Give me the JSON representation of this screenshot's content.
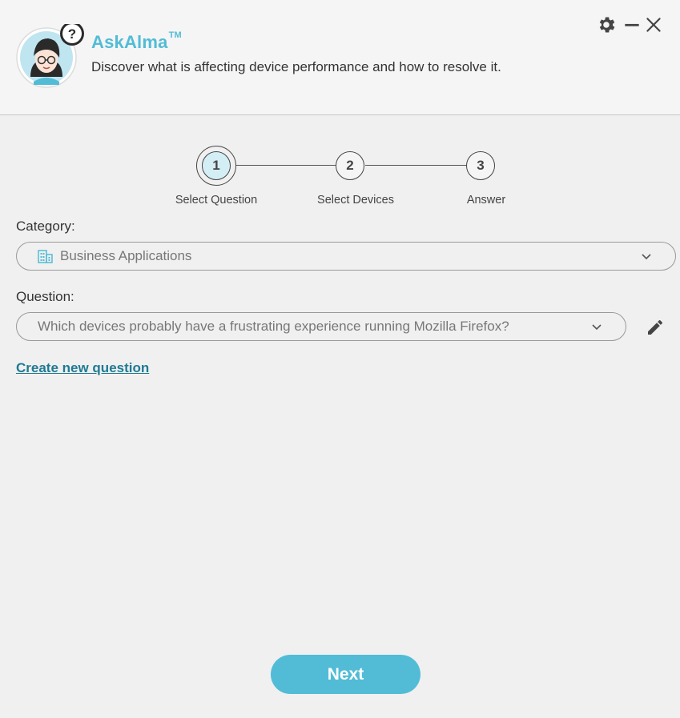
{
  "header": {
    "title": "AskAlma",
    "trademark": "TM",
    "subtitle": "Discover what is affecting device performance and how to resolve it.",
    "help_badge": "?"
  },
  "window_controls": [
    "gear-icon",
    "minimize-icon",
    "close-icon"
  ],
  "stepper": {
    "steps": [
      {
        "number": "1",
        "label": "Select Question",
        "active": true
      },
      {
        "number": "2",
        "label": "Select Devices",
        "active": false
      },
      {
        "number": "3",
        "label": "Answer",
        "active": false
      }
    ]
  },
  "category": {
    "label": "Category:",
    "value": "Business Applications",
    "icon": "building-icon"
  },
  "question": {
    "label": "Question:",
    "value": "Which devices probably have a frustrating experience running Mozilla Firefox?",
    "edit_icon": "pencil-icon"
  },
  "create_link": "Create new question",
  "next_button": "Next",
  "colors": {
    "accent": "#52bcd6",
    "link": "#1f7a93",
    "active_step_fill": "#d4eef5",
    "background": "#f0f0f0",
    "header_background": "#f5f5f5"
  }
}
